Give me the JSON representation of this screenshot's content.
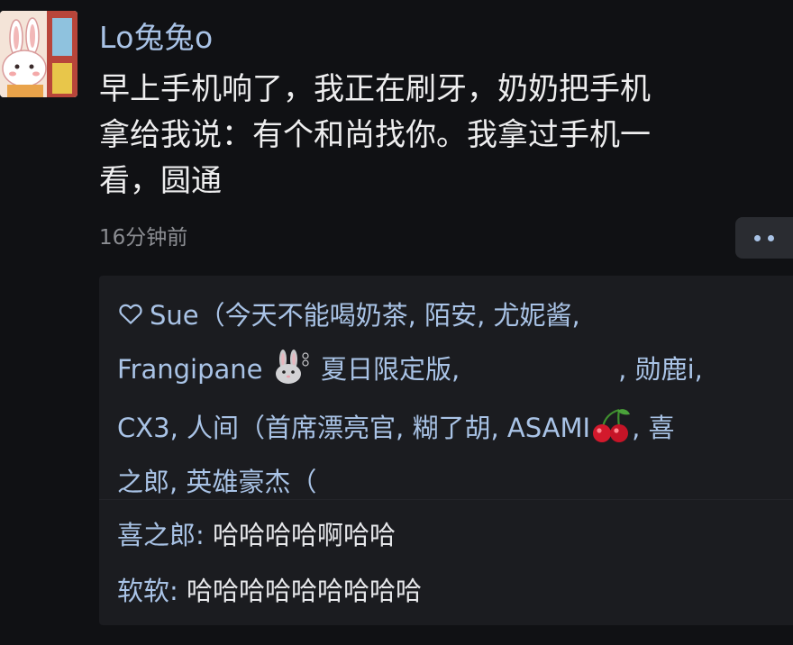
{
  "post": {
    "author": "Lo兔兔o",
    "text_lines": [
      "早上手机响了，我正在刷牙，奶奶把手机",
      "拿给我说：有个和尚找你。我拿过手机一",
      "看，圆通"
    ],
    "timestamp": "16分钟前"
  },
  "likes": {
    "row1": "Sue（今天不能喝奶茶, 陌安, 尤妮酱,",
    "row2_a": "Frangipane",
    "row2_b": "夏日限定版,",
    "row2_c": ", 勋鹿i,",
    "row3_a": "CX3, 人间（首席漂亮官, 糊了胡, ASAMI",
    "row3_b": ", 喜",
    "row4": "之郎, 英雄豪杰（"
  },
  "comments": [
    {
      "author": "喜之郎",
      "sep": ": ",
      "content": "哈哈哈哈啊哈哈"
    },
    {
      "author": "软软",
      "sep": ": ",
      "content": "哈哈哈哈哈哈哈哈哈"
    }
  ],
  "icons": {
    "heart": "heart-icon",
    "rabbit": "rabbit-emoji-icon",
    "cherry": "cherry-emoji-icon",
    "more": "more-dots-icon"
  },
  "colors": {
    "background": "#101114",
    "panel": "#1b1c20",
    "link": "#a9c3e6",
    "text": "#eeeeef",
    "muted": "#8b8d92"
  }
}
